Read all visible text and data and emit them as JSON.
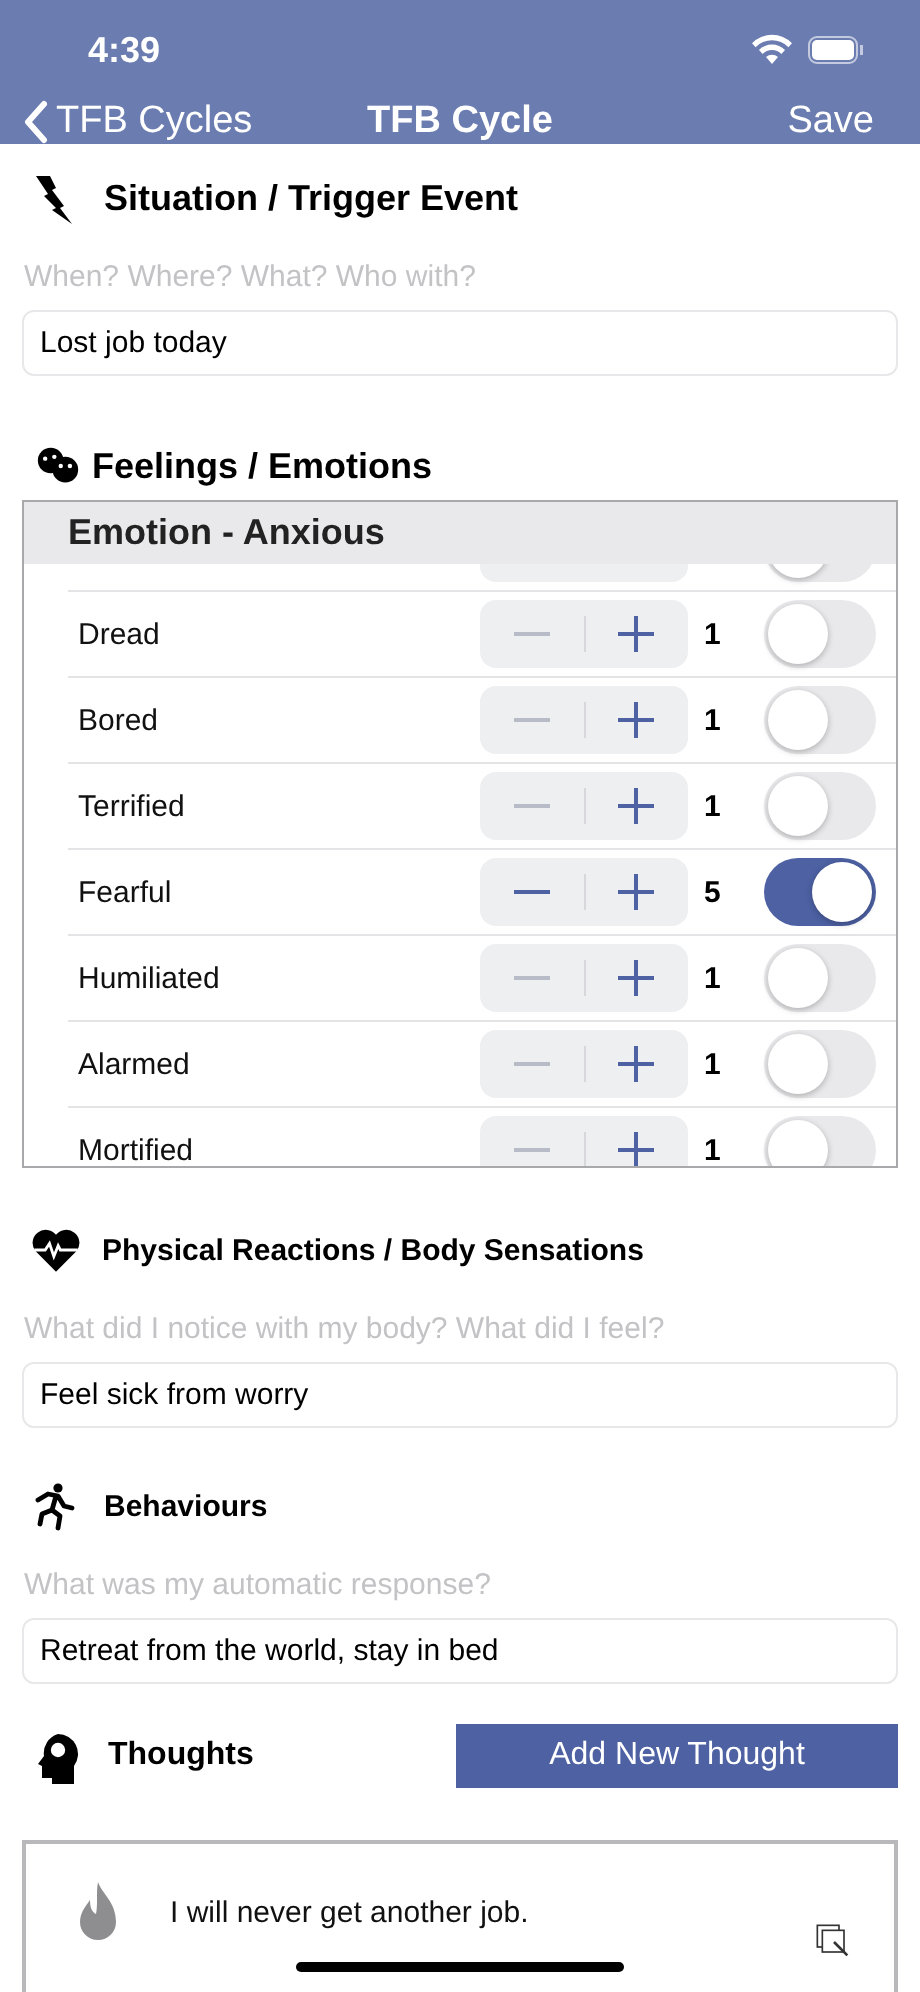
{
  "status_bar": {
    "time": "4:39"
  },
  "nav": {
    "back": "TFB Cycles",
    "title": "TFB Cycle",
    "action": "Save"
  },
  "situation": {
    "title": "Situation / Trigger Event",
    "hint": "When? Where? What? Who with?",
    "value": "Lost job today"
  },
  "feelings": {
    "title": "Feelings / Emotions",
    "group": "Emotion - Anxious",
    "emotions": [
      {
        "on": false
      },
      {
        "name": "Dread",
        "count": "1",
        "on": false,
        "decrement_disabled": true
      },
      {
        "name": "Bored",
        "count": "1",
        "on": false,
        "decrement_disabled": true
      },
      {
        "name": "Terrified",
        "count": "1",
        "on": false,
        "decrement_disabled": true
      },
      {
        "name": "Fearful",
        "count": "5",
        "on": true,
        "decrement_disabled": false
      },
      {
        "name": "Humiliated",
        "count": "1",
        "on": false,
        "decrement_disabled": true
      },
      {
        "name": "Alarmed",
        "count": "1",
        "on": false,
        "decrement_disabled": true
      },
      {
        "name": "Mortified",
        "count": "1",
        "on": false,
        "decrement_disabled": true
      }
    ]
  },
  "physical": {
    "title": "Physical Reactions / Body Sensations",
    "hint": "What did I notice with my body? What did I feel?",
    "value": "Feel sick from worry"
  },
  "behaviours": {
    "title": "Behaviours",
    "hint": "What was my automatic response?",
    "value": "Retreat from the world, stay in bed"
  },
  "thoughts": {
    "title": "Thoughts",
    "button": "Add New Thought",
    "items": [
      {
        "text": "I will never get another job."
      }
    ]
  }
}
